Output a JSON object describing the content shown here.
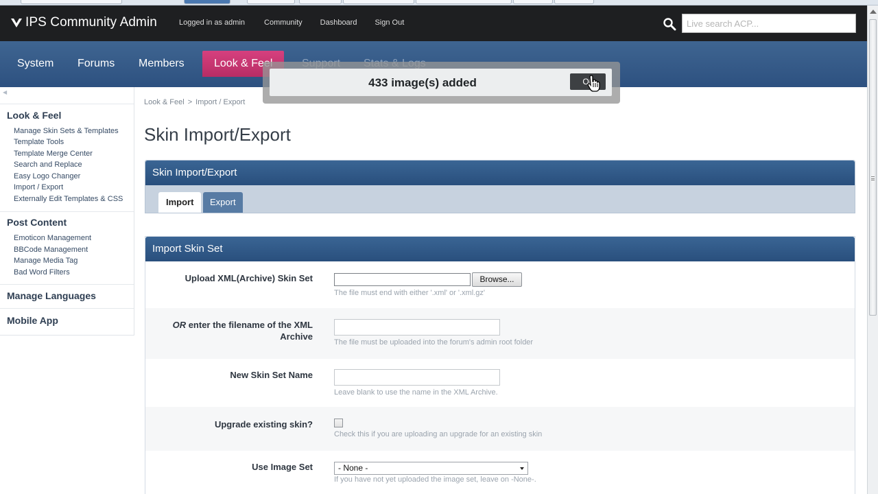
{
  "header": {
    "app_title": "IPS Community Admin",
    "logged_in": "Logged in as admin",
    "links": [
      "Community",
      "Dashboard",
      "Sign Out"
    ],
    "search_placeholder": "Live search ACP..."
  },
  "nav": {
    "items": [
      "System",
      "Forums",
      "Members",
      "Look & Feel",
      "Support",
      "Stats & Logs"
    ],
    "active": "Look & Feel"
  },
  "sidebar": {
    "sections": [
      {
        "heading": "Look & Feel",
        "links": [
          "Manage Skin Sets & Templates",
          "Template Tools",
          "Template Merge Center",
          "Search and Replace",
          "Easy Logo Changer",
          "Import / Export",
          "Externally Edit Templates & CSS"
        ]
      },
      {
        "heading": "Post Content",
        "links": [
          "Emoticon Management",
          "BBCode Management",
          "Manage Media Tag",
          "Bad Word Filters"
        ]
      },
      {
        "heading": "Manage Languages",
        "links": []
      },
      {
        "heading": "Mobile App",
        "links": []
      }
    ]
  },
  "breadcrumb": [
    "Look & Feel",
    ">",
    "Import / Export"
  ],
  "page_title": "Skin Import/Export",
  "panel1": {
    "title": "Skin Import/Export",
    "tabs": [
      "Import",
      "Export"
    ],
    "active_tab": "Import"
  },
  "panel2": {
    "title": "Import Skin Set",
    "rows": {
      "upload": {
        "label": "Upload XML(Archive) Skin Set",
        "button": "Browse...",
        "hint": "The file must end with either '.xml' or '.xml.gz'"
      },
      "filename": {
        "label_em": "OR",
        "label_rest": " enter the filename of the XML Archive",
        "hint": "The file must be uploaded into the forum's admin root folder"
      },
      "name": {
        "label": "New Skin Set Name",
        "hint": "Leave blank to use the name in the XML Archive."
      },
      "upgrade": {
        "label": "Upgrade existing skin?",
        "hint": "Check this if you are uploading an upgrade for an existing skin"
      },
      "imageset": {
        "label": "Use Image Set",
        "selected": "- None -",
        "hint": "If you have not yet uploaded the image set, leave on -None-."
      }
    }
  },
  "popup": {
    "message": "433 image(s) added",
    "button": "Ok"
  },
  "colors": {
    "topbar": "#1e1f21",
    "nav": "#335887",
    "nav_active": "#c9346f",
    "panel_head": "#30598a"
  }
}
